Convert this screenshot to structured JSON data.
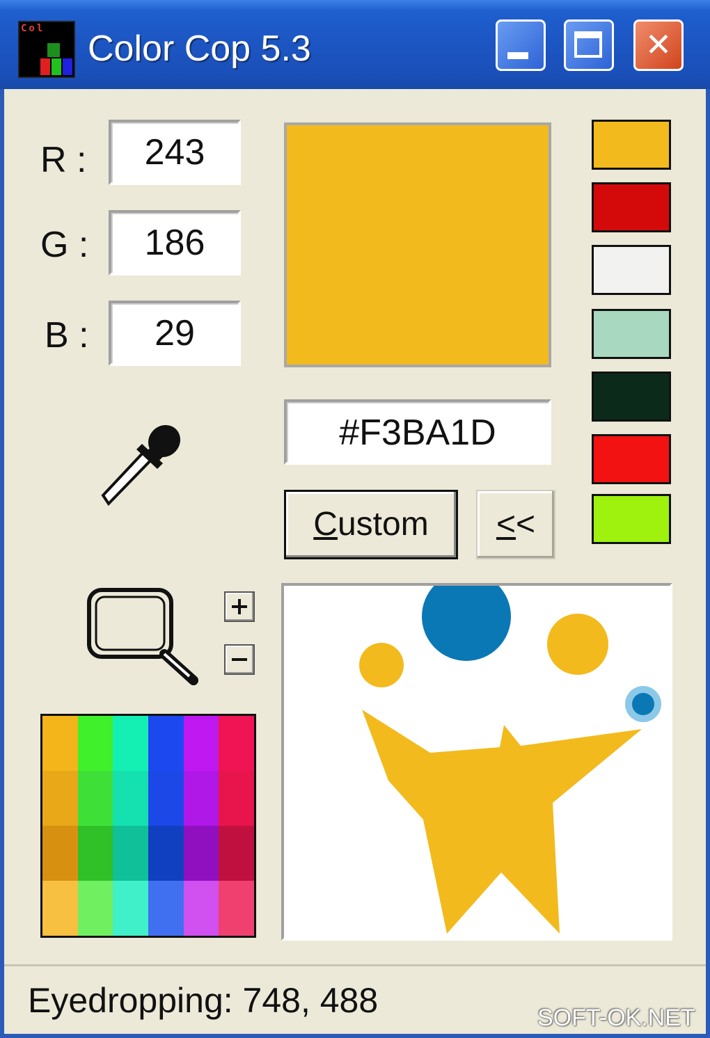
{
  "window": {
    "title": "Color Cop 5.3",
    "buttons": {
      "minimize": "minimize",
      "maximize": "maximize",
      "close": "✕"
    }
  },
  "rgb": {
    "r_label": "R :",
    "r_value": "243",
    "g_label": "G :",
    "g_value": "186",
    "b_label": "B :",
    "b_value": "29"
  },
  "color": {
    "current": "#f3ba1d",
    "hex": "#F3BA1D"
  },
  "buttons": {
    "custom": "Custom",
    "custom_mnemonic": "C",
    "custom_rest": "ustom",
    "back": "<<",
    "back_mnemonic": "<",
    "back_rest": "<"
  },
  "history": [
    "#f3ba1d",
    "#d40a0a",
    "#f2f2f0",
    "#a8d8c0",
    "#0c2a1a",
    "#f21212",
    "#9ef20e"
  ],
  "icons": {
    "eyedropper": "eyedropper-icon",
    "magnifier": "magnifier-icon",
    "zoom_in": "plus-icon",
    "zoom_out": "minus-icon"
  },
  "palette": [
    [
      "#f3b51a",
      "#3ff02a",
      "#14f0b4",
      "#1c48f0",
      "#c018f0",
      "#f01454"
    ],
    [
      "#e8a818",
      "#3ee038",
      "#14e0b0",
      "#1c48e8",
      "#b018e8",
      "#e8144c"
    ],
    [
      "#d89010",
      "#30c028",
      "#10c098",
      "#1040c0",
      "#9010c0",
      "#c01040"
    ],
    [
      "#f8c040",
      "#70f060",
      "#40f0c8",
      "#4070f0",
      "#d050f0",
      "#f04070"
    ]
  ],
  "zoom_preview": {
    "colors": {
      "yellow": "#f3ba1d",
      "blue": "#0a78b4",
      "light_blue": "#8cc8e8",
      "white": "#ffffff"
    }
  },
  "status": {
    "text": "Eyedropping: 748, 488"
  },
  "watermark": "SOFT-OK.NET"
}
